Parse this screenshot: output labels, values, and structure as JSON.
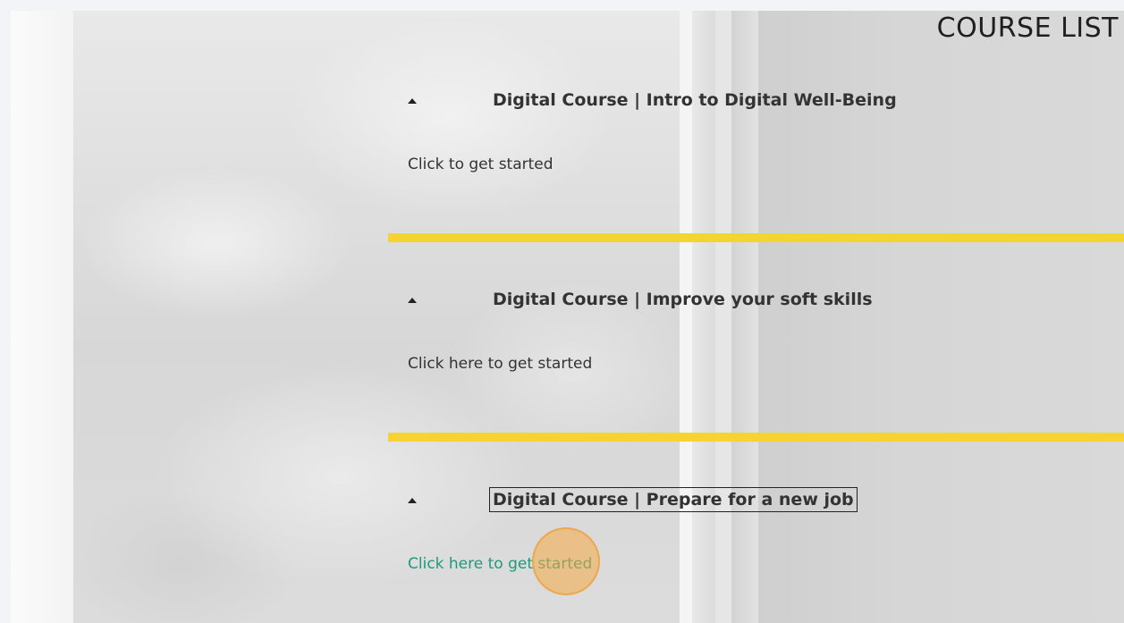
{
  "page": {
    "title": "COURSE LIST"
  },
  "courses": [
    {
      "title": "Digital Course | Intro to Digital Well-Being",
      "link": "Click to get started"
    },
    {
      "title": "Digital Course | Improve your soft skills",
      "link": "Click here to get started"
    },
    {
      "title": "Digital Course | Prepare for a new job",
      "link": "Click here to get started"
    }
  ],
  "colors": {
    "divider": "#f5d332",
    "active_link": "#1f9a7a",
    "click_indicator": "#f5aa46"
  },
  "icons": {
    "expand": "triangle-up-icon"
  }
}
